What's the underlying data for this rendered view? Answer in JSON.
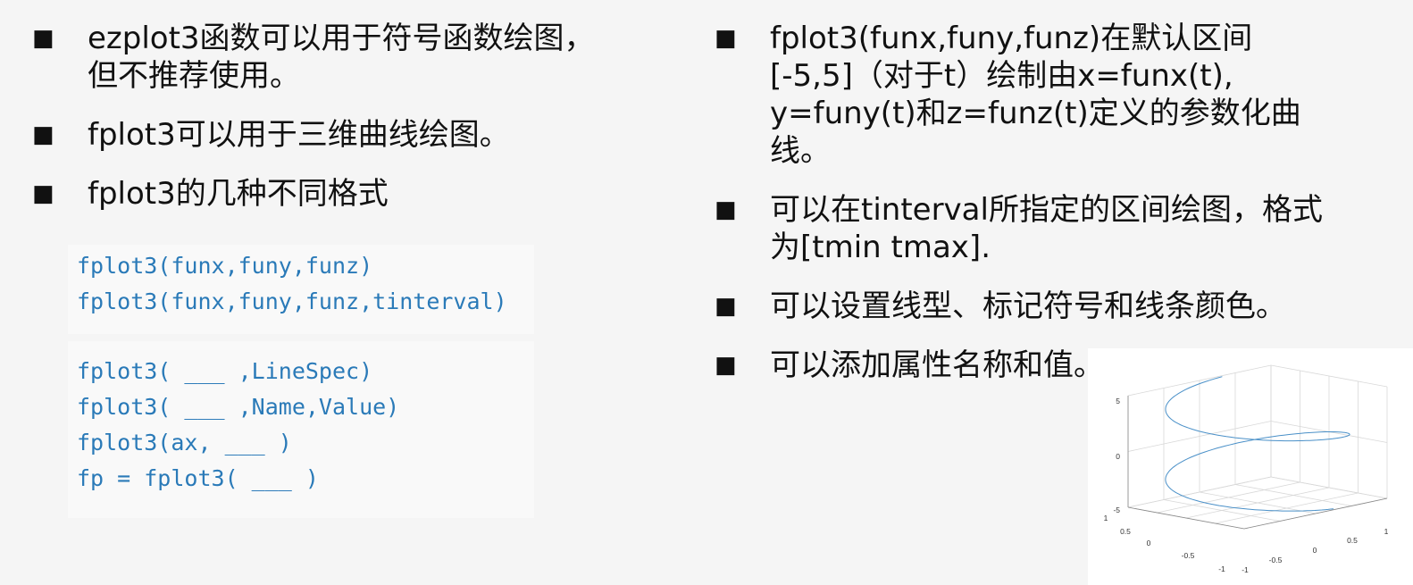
{
  "left": {
    "bullets": [
      "ezplot3函数可以用于符号函数绘图，但不推荐使用。",
      "fplot3可以用于三维曲线绘图。",
      "fplot3的几种不同格式"
    ],
    "code_top": [
      "fplot3(funx,funy,funz)",
      "fplot3(funx,funy,funz,tinterval)"
    ],
    "code_bottom": [
      "fplot3( ___ ,LineSpec)",
      "fplot3( ___ ,Name,Value)",
      "fplot3(ax, ___ )",
      "fp = fplot3( ___ )"
    ]
  },
  "right": {
    "bullets": [
      "fplot3(funx,funy,funz)在默认区间[-5,5]（对于t）绘制由x=funx(t), y=funy(t)和z=funz(t)定义的参数化曲线。",
      "可以在tinterval所指定的区间绘图，格式为[tmin tmax].",
      "可以设置线型、标记符号和线条颜色。",
      "可以添加属性名称和值。"
    ]
  },
  "bullet_symbol": "■",
  "plot": {
    "z_ticks": [
      "5",
      "0",
      "-5"
    ],
    "x_ticks": [
      "1",
      "0.5",
      "0",
      "-0.5",
      "-1"
    ],
    "y_ticks": [
      "-1",
      "-0.5",
      "0",
      "0.5",
      "1"
    ],
    "line_color": "#4a90c8",
    "grid_color": "#d8d8d8"
  }
}
